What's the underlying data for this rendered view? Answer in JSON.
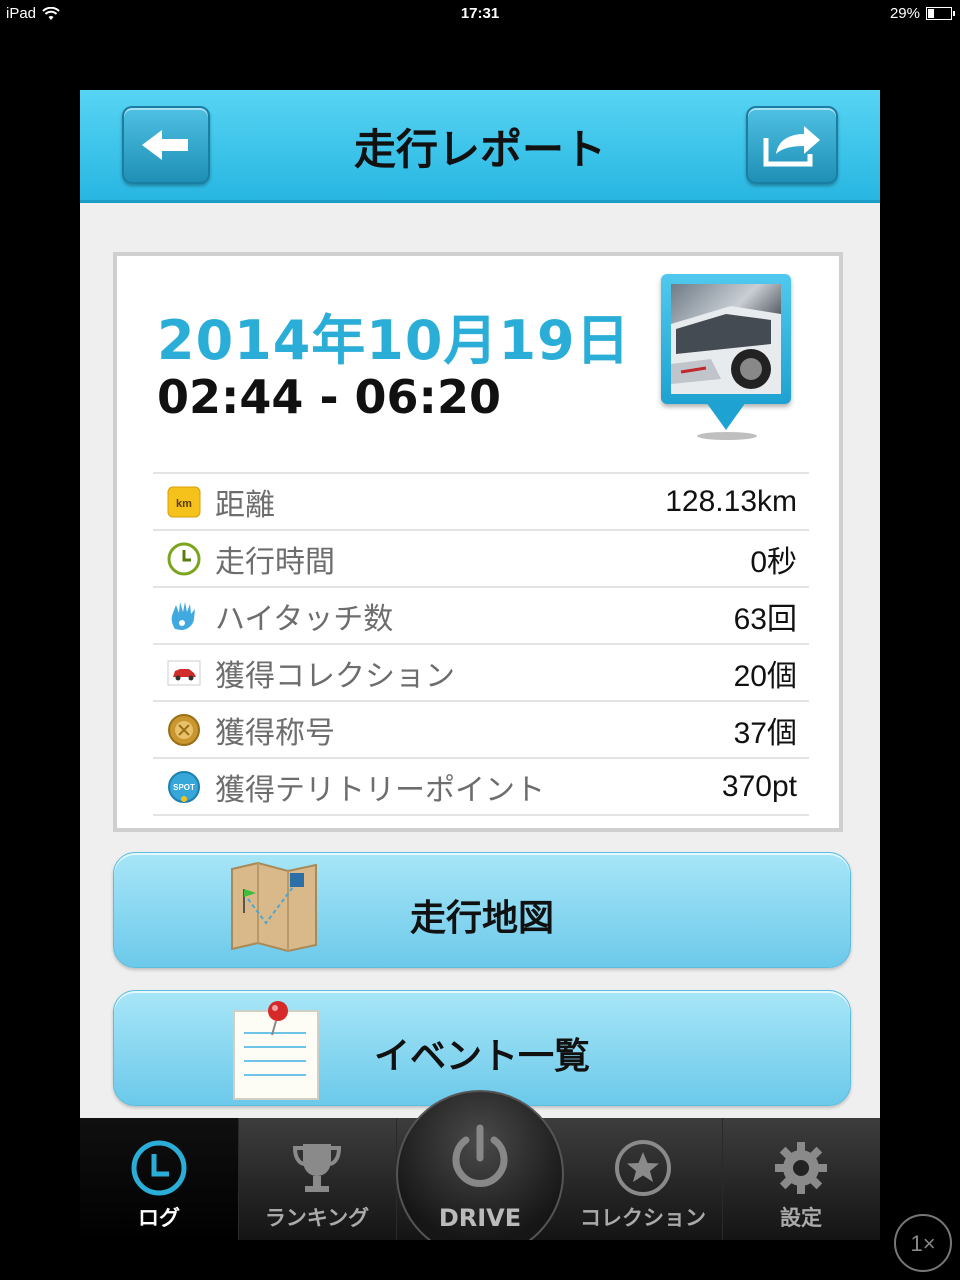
{
  "status_bar": {
    "device": "iPad",
    "time": "17:31",
    "battery": "29%",
    "battery_level": 0.29
  },
  "header": {
    "title": "走行レポート"
  },
  "report": {
    "date": "2014年10月19日",
    "time_range": "02:44 - 06:20",
    "stats": [
      {
        "icon": "km-icon",
        "label": "距離",
        "value": "128.13km"
      },
      {
        "icon": "clock-icon",
        "label": "走行時間",
        "value": "0秒"
      },
      {
        "icon": "hand-icon",
        "label": "ハイタッチ数",
        "value": "63回"
      },
      {
        "icon": "car-icon",
        "label": "獲得コレクション",
        "value": "20個"
      },
      {
        "icon": "medal-icon",
        "label": "獲得称号",
        "value": "37個"
      },
      {
        "icon": "spot-icon",
        "label": "獲得テリトリーポイント",
        "value": "370pt"
      }
    ],
    "km_icon_text": "km",
    "spot_icon_text": "SPOT"
  },
  "actions": {
    "map": "走行地図",
    "events": "イベント一覧"
  },
  "tabbar": {
    "log": "ログ",
    "ranking": "ランキング",
    "drive": "DRIVE",
    "collection": "コレクション",
    "settings": "設定"
  },
  "zoom": "1×",
  "colors": {
    "header": "#27b6e1",
    "date": "#2aaed8",
    "active_tab": "#2aaed8"
  }
}
